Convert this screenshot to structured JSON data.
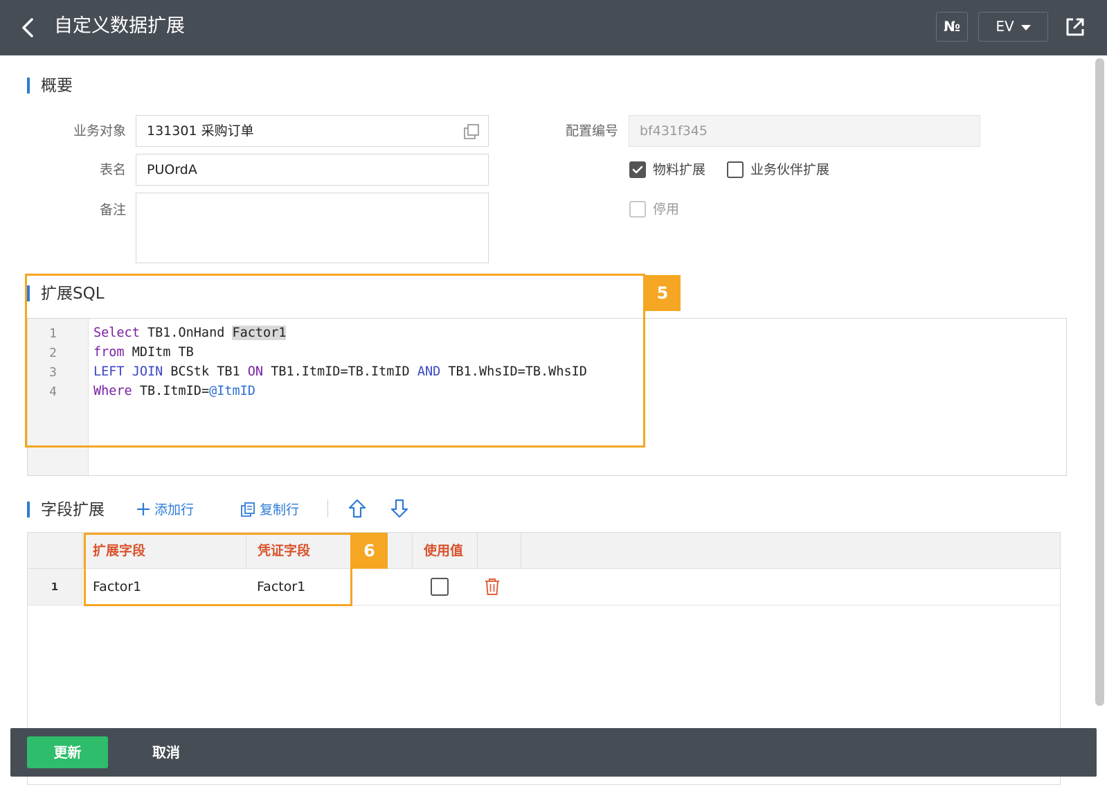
{
  "header": {
    "title": "自定义数据扩展",
    "no_button": "№",
    "env_selector": "EV"
  },
  "overview": {
    "section_title": "概要",
    "business_object_label": "业务对象",
    "business_object_value": "131301 采购订单",
    "table_name_label": "表名",
    "table_name_value": "PUOrdA",
    "remark_label": "备注",
    "remark_value": "",
    "config_no_label": "配置编号",
    "config_no_value": "bf431f345",
    "material_ext_label": "物料扩展",
    "material_ext_checked": true,
    "partner_ext_label": "业务伙伴扩展",
    "partner_ext_checked": false,
    "disabled_label": "停用",
    "disabled_checked": false
  },
  "sql": {
    "section_title": "扩展SQL",
    "line_numbers": [
      "1",
      "2",
      "3",
      "4"
    ],
    "annotation": "5"
  },
  "fields": {
    "section_title": "字段扩展",
    "add_row": "添加行",
    "copy_row": "复制行",
    "columns": [
      "扩展字段",
      "凭证字段",
      "使用值"
    ],
    "rows": [
      {
        "index": "1",
        "ext_field": "Factor1",
        "voucher_field": "Factor1",
        "use_value": false
      }
    ],
    "annotation": "6"
  },
  "footer": {
    "update": "更新",
    "cancel": "取消"
  }
}
